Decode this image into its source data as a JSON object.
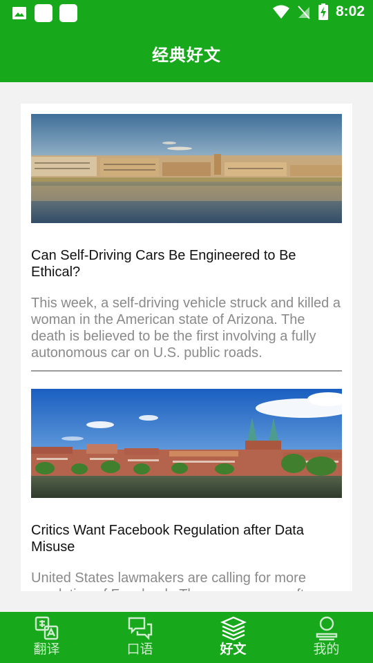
{
  "status_bar": {
    "time": "8:02"
  },
  "app_bar": {
    "title": "经典好文"
  },
  "articles": [
    {
      "title": "Can Self-Driving Cars Be Engineered to Be Ethical?",
      "summary": "This week, a self-driving vehicle struck and killed a woman in the American state of Arizona. The death is believed to be the first involving a fully autonomous car on U.S. public roads."
    },
    {
      "title": "Critics Want Facebook Regulation after Data Misuse",
      "summary": "United States lawmakers are calling for more regulation of Facebook. The move comes after"
    }
  ],
  "bottom_nav": {
    "items": [
      {
        "label": "翻译",
        "icon": "translate-icon"
      },
      {
        "label": "口语",
        "icon": "chat-bubbles-icon"
      },
      {
        "label": "好文",
        "icon": "stacked-books-icon"
      },
      {
        "label": "我的",
        "icon": "person-icon"
      }
    ],
    "active_index": 2
  },
  "colors": {
    "primary": "#17a81b",
    "summary_text": "#8a8a8a"
  }
}
